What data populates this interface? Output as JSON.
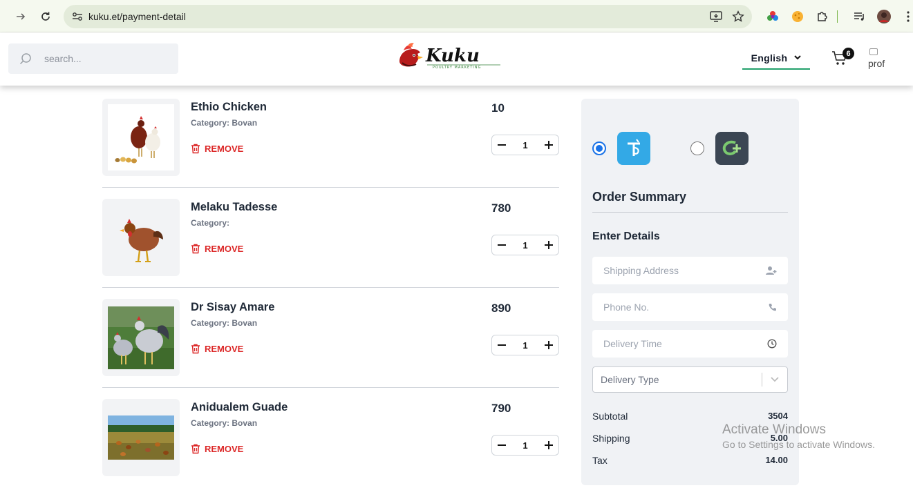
{
  "browser": {
    "url": "kuku.et/payment-detail"
  },
  "header": {
    "search_placeholder": "search...",
    "language": "English",
    "cart_count": "6",
    "avatar_alt": "prof"
  },
  "items": [
    {
      "name": "Ethio Chicken",
      "category": "Category: Bovan",
      "remove": "REMOVE",
      "price": "10",
      "qty": "1"
    },
    {
      "name": "Melaku Tadesse",
      "category": "Category:",
      "remove": "REMOVE",
      "price": "780",
      "qty": "1"
    },
    {
      "name": "Dr Sisay Amare",
      "category": "Category: Bovan",
      "remove": "REMOVE",
      "price": "890",
      "qty": "1"
    },
    {
      "name": "Anidualem Guade",
      "category": "Category: Bovan",
      "remove": "REMOVE",
      "price": "790",
      "qty": "1"
    }
  ],
  "summary": {
    "title": "Order Summary",
    "details_title": "Enter Details",
    "shipping_address_placeholder": "Shipping Address",
    "phone_placeholder": "Phone No.",
    "delivery_time_placeholder": "Delivery Time",
    "delivery_type": "Delivery Type",
    "subtotal_label": "Subtotal",
    "subtotal_value": "3504",
    "shipping_label": "Shipping",
    "shipping_value": "5.00",
    "tax_label": "Tax",
    "tax_value": "14.00"
  },
  "payment_options": [
    {
      "icon": "telebirr-icon",
      "selected": true
    },
    {
      "icon": "chapa-icon",
      "selected": false
    }
  ],
  "watermark": {
    "line1": "Activate Windows",
    "line2": "Go to Settings to activate Windows."
  },
  "colors": {
    "accent_green": "#22a06b",
    "remove_red": "#dc2626",
    "radio_blue": "#1a73e8"
  }
}
